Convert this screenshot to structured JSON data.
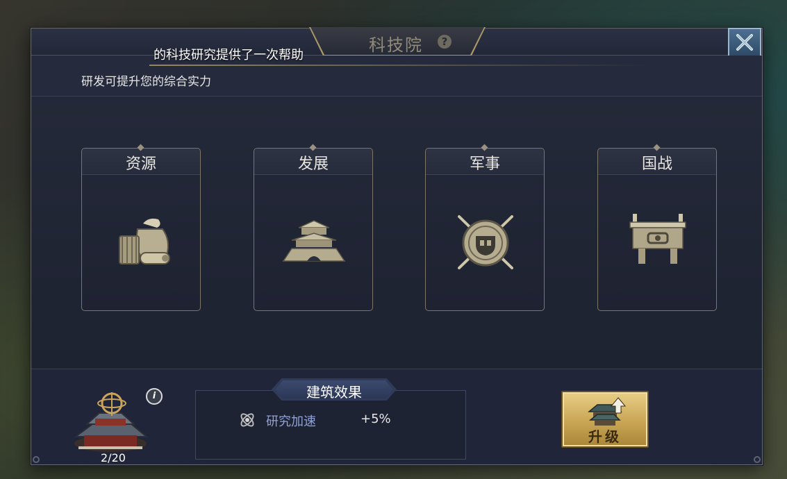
{
  "window": {
    "title": "科技院",
    "help_symbol": "?",
    "close_symbol": "✕",
    "notice": "的科技研究提供了一次帮助",
    "subtitle": "研发可提升您的综合实力"
  },
  "categories": [
    {
      "label": "资源",
      "icon": "resource-sacks-icon"
    },
    {
      "label": "发展",
      "icon": "palace-gate-icon"
    },
    {
      "label": "军事",
      "icon": "crossed-swords-shield-icon"
    },
    {
      "label": "国战",
      "icon": "bronze-ding-cauldron-icon"
    }
  ],
  "footer": {
    "building_icon": "academy-building-icon",
    "level": "2/20",
    "info_symbol": "i",
    "effect_title": "建筑效果",
    "effect_icon": "research-atom-icon",
    "effect_name": "研究加速",
    "effect_value": "+5%",
    "upgrade_label": "升级",
    "upgrade_icon": "building-upgrade-arrow-icon"
  },
  "colors": {
    "panel_bg": "#1f2433",
    "card_border": "#7d7668",
    "gold_button": "#c9a555",
    "effect_name_color": "#8fa2d6",
    "close_button": "#3f6183"
  }
}
